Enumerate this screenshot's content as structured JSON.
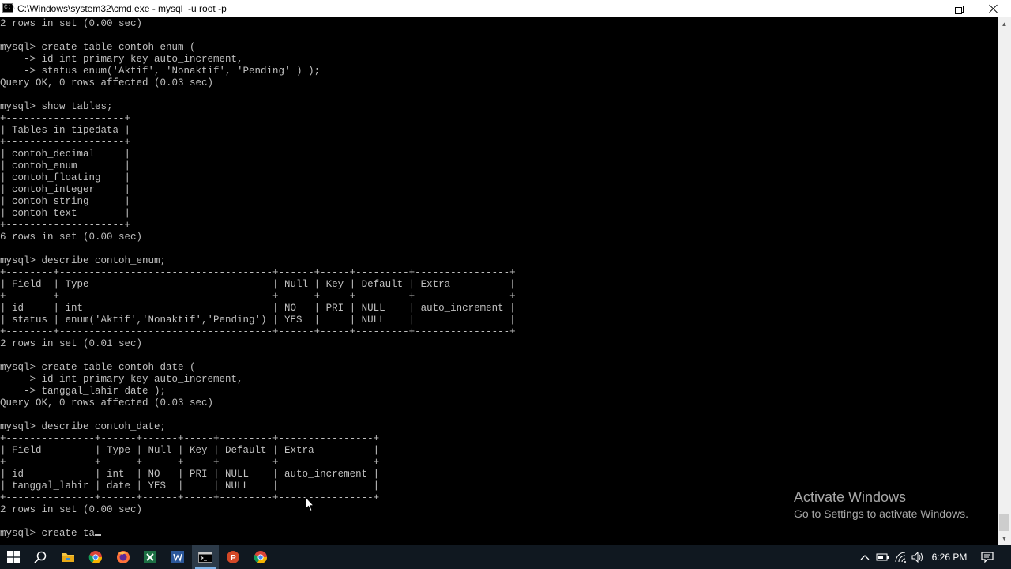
{
  "window": {
    "title": "C:\\Windows\\system32\\cmd.exe - mysql  -u root -p",
    "icon_text": "C:\\"
  },
  "console": {
    "lines": [
      "2 rows in set (0.00 sec)",
      "",
      "mysql> create table contoh_enum (",
      "    -> id int primary key auto_increment,",
      "    -> status enum('Aktif', 'Nonaktif', 'Pending' ) );",
      "Query OK, 0 rows affected (0.03 sec)",
      "",
      "mysql> show tables;",
      "+--------------------+",
      "| Tables_in_tipedata |",
      "+--------------------+",
      "| contoh_decimal     |",
      "| contoh_enum        |",
      "| contoh_floating    |",
      "| contoh_integer     |",
      "| contoh_string      |",
      "| contoh_text        |",
      "+--------------------+",
      "6 rows in set (0.00 sec)",
      "",
      "mysql> describe contoh_enum;",
      "+--------+------------------------------------+------+-----+---------+----------------+",
      "| Field  | Type                               | Null | Key | Default | Extra          |",
      "+--------+------------------------------------+------+-----+---------+----------------+",
      "| id     | int                                | NO   | PRI | NULL    | auto_increment |",
      "| status | enum('Aktif','Nonaktif','Pending') | YES  |     | NULL    |                |",
      "+--------+------------------------------------+------+-----+---------+----------------+",
      "2 rows in set (0.01 sec)",
      "",
      "mysql> create table contoh_date (",
      "    -> id int primary key auto_increment,",
      "    -> tanggal_lahir date );",
      "Query OK, 0 rows affected (0.03 sec)",
      "",
      "mysql> describe contoh_date;",
      "+---------------+------+------+-----+---------+----------------+",
      "| Field         | Type | Null | Key | Default | Extra          |",
      "+---------------+------+------+-----+---------+----------------+",
      "| id            | int  | NO   | PRI | NULL    | auto_increment |",
      "| tanggal_lahir | date | YES  |     | NULL    |                |",
      "+---------------+------+------+-----+---------+----------------+",
      "2 rows in set (0.00 sec)",
      ""
    ],
    "input_line": "mysql> create ta"
  },
  "watermark": {
    "title": "Activate Windows",
    "subtitle": "Go to Settings to activate Windows."
  },
  "taskbar": {
    "icons": [
      "windows-start-icon",
      "search-icon",
      "file-explorer-icon",
      "chrome-icon",
      "firefox-icon",
      "excel-icon",
      "word-icon",
      "cmd-icon",
      "powerpoint-icon",
      "chrome-icon-2"
    ],
    "clock": "6:26 PM"
  }
}
